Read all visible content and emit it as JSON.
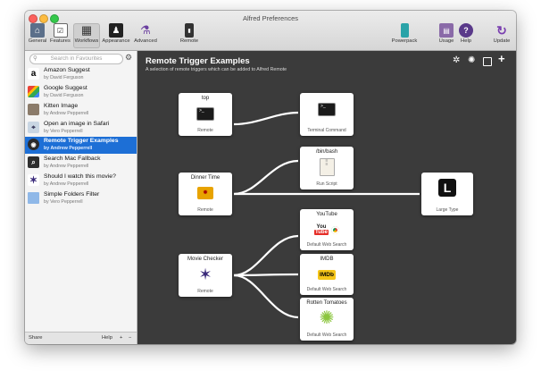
{
  "window": {
    "title": "Alfred Preferences"
  },
  "toolbar": {
    "general": "General",
    "features": "Features",
    "workflows": "Workflows",
    "appearance": "Appearance",
    "advanced": "Advanced",
    "remote": "Remote",
    "powerpack": "Powerpack",
    "usage": "Usage",
    "help": "Help",
    "update": "Update"
  },
  "sidebar": {
    "search_placeholder": "Search in Favourites",
    "items": [
      {
        "name": "Amazon Suggest",
        "by": "by David Ferguson",
        "icon": "amazon-icon"
      },
      {
        "name": "Google Suggest",
        "by": "by David Ferguson",
        "icon": "google-icon"
      },
      {
        "name": "Kitten Image",
        "by": "by Andrew Pepperrell",
        "icon": "kitten-icon"
      },
      {
        "name": "Open an image in Safari",
        "by": "by Vero Pepperrell",
        "icon": "safari-icon"
      },
      {
        "name": "Remote Trigger Examples",
        "by": "by Andrew Pepperrell",
        "icon": "remote-icon"
      },
      {
        "name": "Search Mac Fallback",
        "by": "by Andrew Pepperrell",
        "icon": "search-icon"
      },
      {
        "name": "Should I watch this movie?",
        "by": "by Andrew Pepperrell",
        "icon": "movie-icon"
      },
      {
        "name": "Simple Folders Filter",
        "by": "by Vero Pepperrell",
        "icon": "folder-icon"
      }
    ],
    "selected_index": 4,
    "bottom": {
      "share": "Share",
      "help": "Help",
      "add": "+",
      "remove": "−"
    }
  },
  "canvas": {
    "title": "Remote Trigger Examples",
    "description": "A selection of remote triggers which can be added to Alfred Remote",
    "nodes": {
      "top": {
        "title": "top",
        "label": "Remote"
      },
      "terminal": {
        "title": "",
        "label": "Terminal Command"
      },
      "bash": {
        "title": "/bin/bash",
        "label": "Run Script"
      },
      "dinner": {
        "title": "Dinner Time",
        "label": "Remote"
      },
      "large": {
        "title": "",
        "label": "Large Type",
        "glyph": "L"
      },
      "youtube": {
        "title": "YouTube",
        "label": "Default Web Search"
      },
      "movie": {
        "title": "Movie Checker",
        "label": "Remote"
      },
      "imdb": {
        "title": "IMDB",
        "label": "Default Web Search",
        "glyph": "IMDb"
      },
      "rotten": {
        "title": "Rotten Tomatoes",
        "label": "Default Web Search"
      }
    },
    "youtube_glyph": {
      "you": "You",
      "tube": "Tube"
    },
    "colors": {
      "canvas_bg": "#3b3b3b",
      "selection": "#1d6fd6",
      "imdb": "#f5c518",
      "rotten_splat": "#8cc63f"
    }
  }
}
